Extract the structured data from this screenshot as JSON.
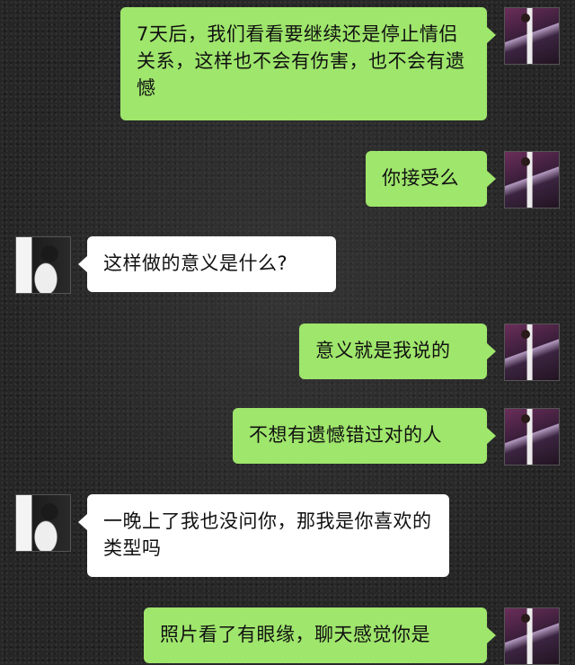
{
  "messages": [
    {
      "side": "me",
      "text": "7天后，我们看看要继续还是停止情侣关系，这样也不会有伤害，也不会有遗憾"
    },
    {
      "side": "me",
      "text": "你接受么"
    },
    {
      "side": "you",
      "text": "这样做的意义是什么?"
    },
    {
      "side": "me",
      "text": "意义就是我说的"
    },
    {
      "side": "me",
      "text": "不想有遗憾错过对的人"
    },
    {
      "side": "you",
      "text": "一晚上了我也没问你，那我是你喜欢的类型吗"
    },
    {
      "side": "me",
      "text": "照片看了有眼缘，聊天感觉你是"
    }
  ]
}
